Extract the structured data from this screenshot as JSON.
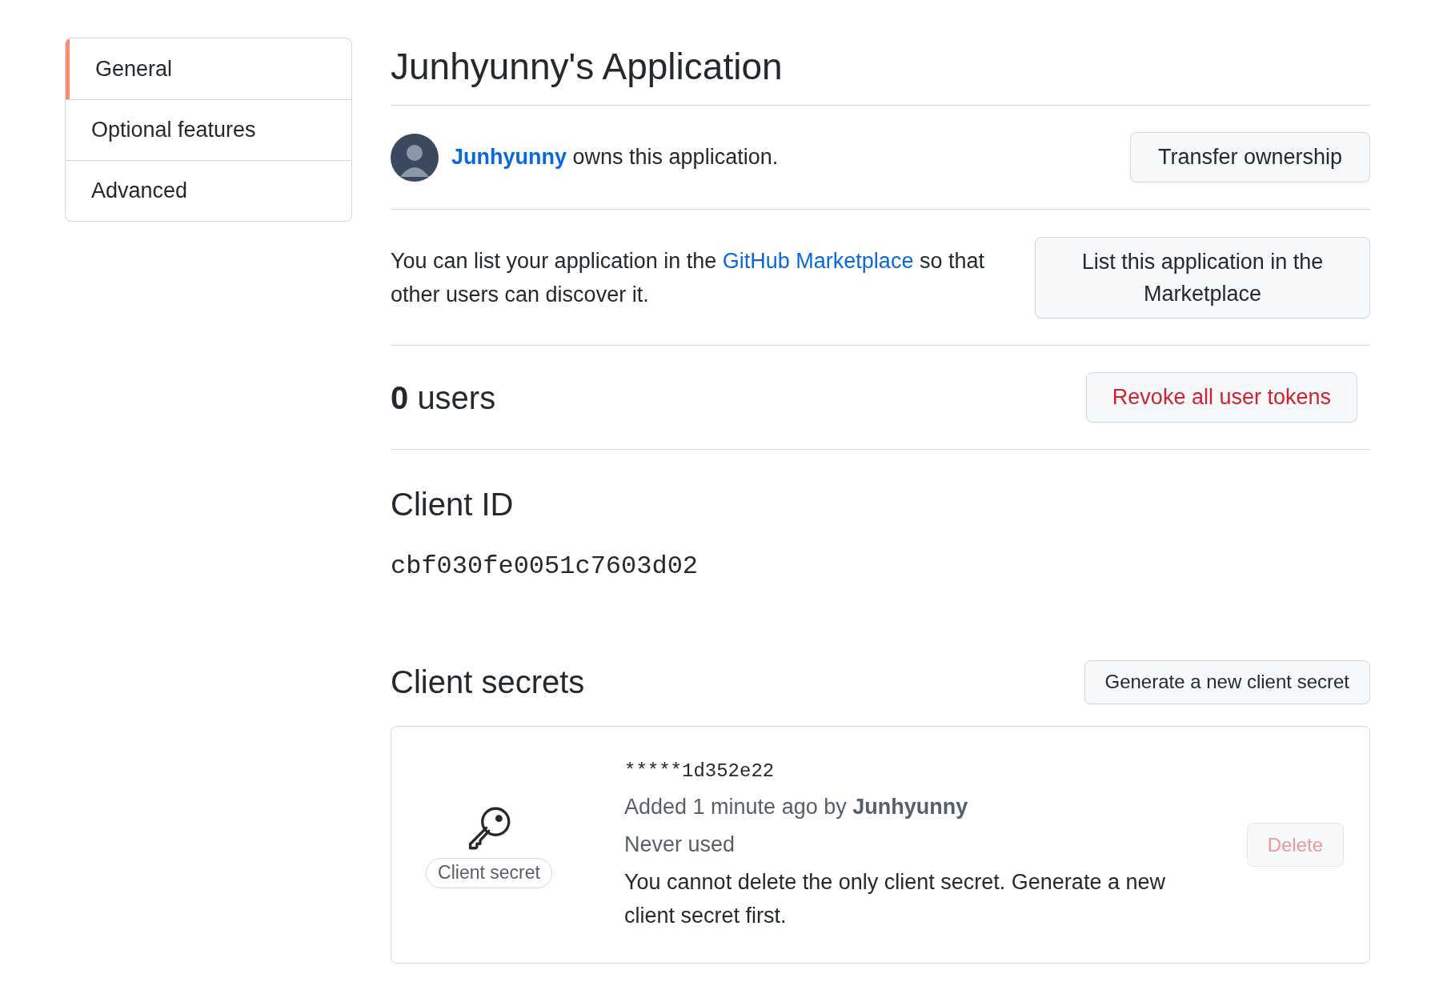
{
  "sidebar": {
    "items": [
      {
        "label": "General",
        "selected": true
      },
      {
        "label": "Optional features",
        "selected": false
      },
      {
        "label": "Advanced",
        "selected": false
      }
    ]
  },
  "title": "Junhyunny's Application",
  "owner": {
    "name": "Junhyunny",
    "text": "owns this application.",
    "button": "Transfer ownership"
  },
  "marketplace": {
    "text": "You can list your application in the",
    "link": "GitHub Marketplace",
    "text_after": "so that other users can discover it.",
    "button": "List this application in the Marketplace"
  },
  "users": {
    "count": "0",
    "label": "users",
    "button": "Revoke all user tokens"
  },
  "client_id": {
    "heading": "Client ID",
    "value": "cbf030fe0051c7603d02"
  },
  "client_secrets": {
    "heading": "Client secrets",
    "button": "Generate a new client secret",
    "secrets": [
      {
        "badge": "Client secret",
        "value": "*****1d352e22",
        "added": "Added 1 minute ago by **Junhyunny**",
        "usage": "Never used",
        "note": "You cannot delete the only client secret. Generate a new client secret first.",
        "delete": {
          "label": "Delete",
          "disabled": true
        }
      }
    ]
  }
}
